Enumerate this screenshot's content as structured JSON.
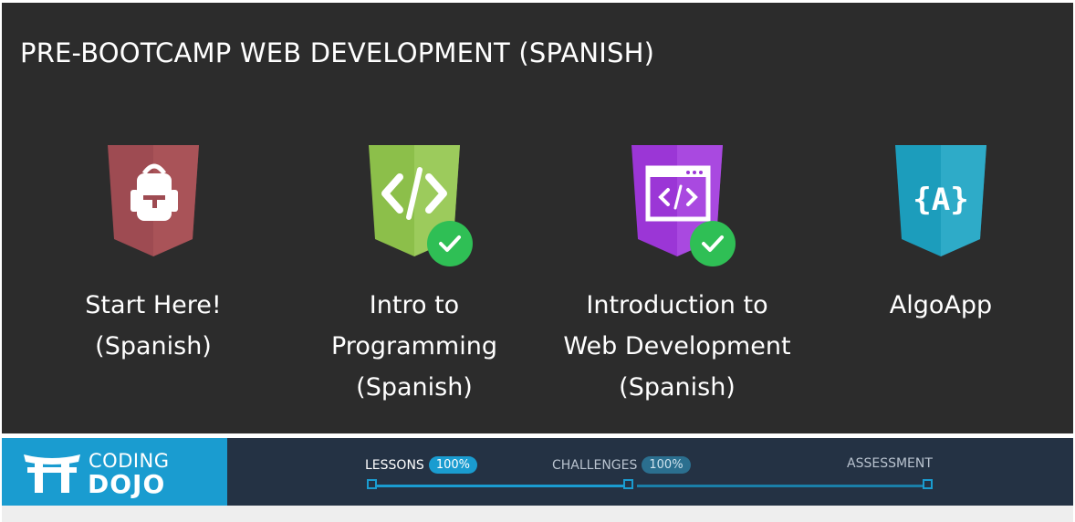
{
  "panel": {
    "title": "PRE-BOOTCAMP WEB DEVELOPMENT (SPANISH)"
  },
  "courses": [
    {
      "label": "Start Here!\n(Spanish)",
      "icon": "backpack-icon",
      "color": "#9e4b52",
      "completed": false
    },
    {
      "label": "Intro to\nProgramming\n(Spanish)",
      "icon": "code-icon",
      "color": "#8cbf4a",
      "completed": true
    },
    {
      "label": "Introduction to\nWeb Development\n(Spanish)",
      "icon": "browser-code-icon",
      "color": "#9b36d6",
      "completed": true
    },
    {
      "label": "AlgoApp",
      "icon": "algo-braces-icon",
      "color": "#1c9dbc",
      "completed": false
    }
  ],
  "nav": {
    "logo_top": "CODING",
    "logo_bottom": "DOJO",
    "steps": [
      {
        "label": "LESSONS",
        "badge": "100%"
      },
      {
        "label": "CHALLENGES",
        "badge": "100%"
      },
      {
        "label": "ASSESSMENT",
        "badge": ""
      }
    ]
  },
  "colors": {
    "panel_bg": "#2c2c2c",
    "nav_bg": "#243244",
    "accent": "#1a9cd0",
    "check": "#2fbf55"
  }
}
